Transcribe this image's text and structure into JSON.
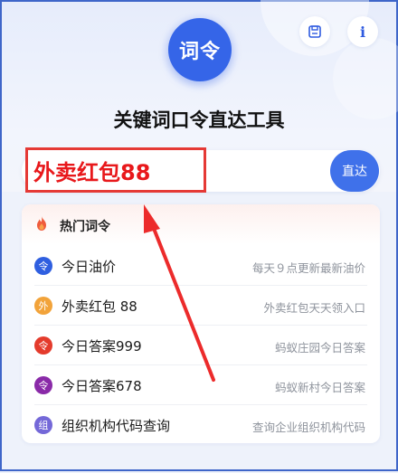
{
  "header": {
    "logo_text": "词令",
    "title": "关键词口令直达工具",
    "info_label": "i"
  },
  "search": {
    "value": "外卖红包88",
    "button_label": "直达"
  },
  "hot": {
    "title": "热门词令",
    "items": [
      {
        "badge": "令",
        "label": "今日油价",
        "desc": "每天９点更新最新油价",
        "color": "#2f5fe0"
      },
      {
        "badge": "外",
        "label": "外卖红包 88",
        "desc": "外卖红包天天领入口",
        "color": "#f2a33a"
      },
      {
        "badge": "令",
        "label": "今日答案999",
        "desc": "蚂蚁庄园今日答案",
        "color": "#e43b2c"
      },
      {
        "badge": "令",
        "label": "今日答案678",
        "desc": "蚂蚁新村今日答案",
        "color": "#8a2aa8"
      },
      {
        "badge": "组",
        "label": "组织机构代码查询",
        "desc": "查询企业组织机构代码",
        "color": "#7468d8"
      }
    ]
  },
  "colors": {
    "accent": "#3f71ea",
    "highlight": "#e53935"
  }
}
